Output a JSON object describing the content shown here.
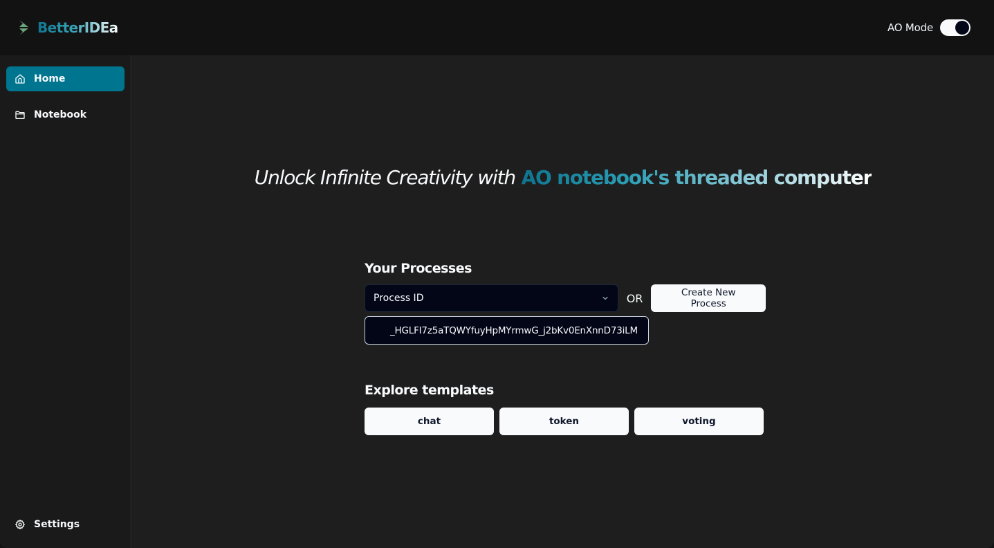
{
  "header": {
    "brand_name": "BetterIDEa",
    "logo_icon": "betteridea-chevron-logo",
    "mode_label": "AO Mode",
    "mode_enabled": true
  },
  "sidebar": {
    "items": [
      {
        "label": "Home",
        "icon": "home-icon",
        "active": true
      },
      {
        "label": "Notebook",
        "icon": "folder-icon",
        "active": false
      }
    ],
    "footer_item": {
      "label": "Settings",
      "icon": "gear-icon"
    }
  },
  "hero": {
    "italic_text": "Unlock Infinite Creativity with",
    "gradient_text": "AO notebook's threaded computer"
  },
  "processes": {
    "title": "Your Processes",
    "select_placeholder": "Process ID",
    "or_label": "OR",
    "create_button": "Create New Process",
    "options": [
      "_HGLFI7z5aTQWYfuyHpMYrmwG_j2bKv0EnXnnD73iLM"
    ]
  },
  "templates": {
    "title": "Explore templates",
    "items": [
      "chat",
      "token",
      "voting"
    ]
  },
  "colors": {
    "accent": "#00758f",
    "background": "#1e1e1e",
    "header": "#121212",
    "logo_green": "#6aa57c"
  }
}
